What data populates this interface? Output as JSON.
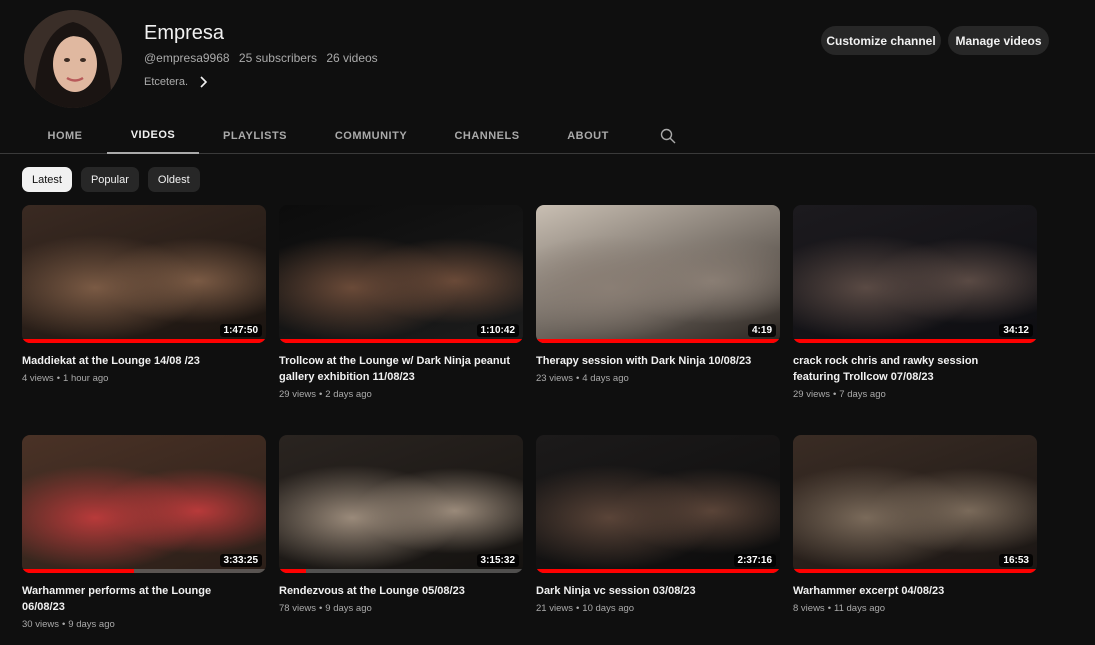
{
  "channel": {
    "name": "Empresa",
    "handle": "@empresa9968",
    "subscribers": "25 subscribers",
    "videos_count": "26 videos",
    "description": "Etcetera.",
    "customize_label": "Customize channel",
    "manage_label": "Manage videos"
  },
  "tabs": [
    {
      "label": "HOME",
      "active": false
    },
    {
      "label": "VIDEOS",
      "active": true
    },
    {
      "label": "PLAYLISTS",
      "active": false
    },
    {
      "label": "COMMUNITY",
      "active": false
    },
    {
      "label": "CHANNELS",
      "active": false
    },
    {
      "label": "ABOUT",
      "active": false
    }
  ],
  "chips": [
    {
      "label": "Latest",
      "active": true
    },
    {
      "label": "Popular",
      "active": false
    },
    {
      "label": "Oldest",
      "active": false
    }
  ],
  "videos": [
    {
      "title": "Maddiekat at the Lounge 14/08 /23",
      "duration": "1:47:50",
      "views": "4 views",
      "age": "1 hour ago",
      "progress": 1.0,
      "palette": [
        "#3a2a22",
        "#7a5a44",
        "#1a1410"
      ]
    },
    {
      "title": "Trollcow at the Lounge w/ Dark Ninja peanut gallery exhibition 11/08/23",
      "duration": "1:10:42",
      "views": "29 views",
      "age": "2 days ago",
      "progress": 1.0,
      "palette": [
        "#0c0c0c",
        "#6a4a38",
        "#1c1c1c"
      ]
    },
    {
      "title": "Therapy session with Dark Ninja 10/08/23",
      "duration": "4:19",
      "views": "23 views",
      "age": "4 days ago",
      "progress": 1.0,
      "palette": [
        "#c9bfb3",
        "#8a7e74",
        "#2a2420"
      ]
    },
    {
      "title": "crack rock chris and rawky session featuring Trollcow 07/08/23",
      "duration": "34:12",
      "views": "29 views",
      "age": "7 days ago",
      "progress": 1.0,
      "palette": [
        "#1c1a1e",
        "#5a4a44",
        "#0e0e12"
      ]
    },
    {
      "title": "Warhammer performs at the Lounge 06/08/23",
      "duration": "3:33:25",
      "views": "30 views",
      "age": "9 days ago",
      "progress": 0.46,
      "palette": [
        "#4a3226",
        "#b83a3a",
        "#2a1e18"
      ]
    },
    {
      "title": "Rendezvous at the Lounge 05/08/23",
      "duration": "3:15:32",
      "views": "78 views",
      "age": "9 days ago",
      "progress": 0.11,
      "palette": [
        "#2a2420",
        "#9a8a7a",
        "#141210"
      ]
    },
    {
      "title": "Dark Ninja vc session 03/08/23",
      "duration": "2:37:16",
      "views": "21 views",
      "age": "10 days ago",
      "progress": 1.0,
      "palette": [
        "#1c1a1a",
        "#5a4438",
        "#0c0c0c"
      ]
    },
    {
      "title": "Warhammer excerpt 04/08/23",
      "duration": "16:53",
      "views": "8 views",
      "age": "11 days ago",
      "progress": 1.0,
      "palette": [
        "#3a2c24",
        "#7a6a5a",
        "#1a1614"
      ]
    }
  ],
  "colors": {
    "accent": "#ff0000",
    "background": "#0f0f0f",
    "chip_bg": "#272727"
  },
  "icons": {
    "search": "search-icon",
    "chevron": "chevron-right-icon"
  }
}
